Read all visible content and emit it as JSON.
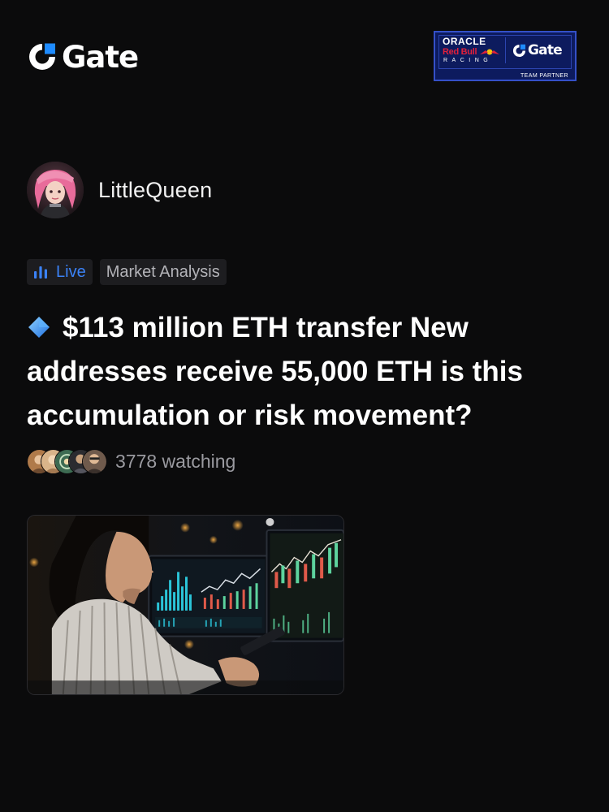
{
  "header": {
    "brand": "Gate",
    "brand_icon": "gate-logo-icon",
    "brand_color": "#1e8bff",
    "partner": {
      "line1": "ORACLE",
      "line2": "Red Bull",
      "line3": "RACING",
      "gate": "Gate",
      "badge": "TEAM PARTNER",
      "bg_color": "#0d1b5e"
    }
  },
  "author": {
    "name": "LittleQueen",
    "avatar_icon": "avatar"
  },
  "tags": {
    "live_label": "Live",
    "live_icon": "bar-chart-icon",
    "live_color": "#3b82f6",
    "category": "Market Analysis"
  },
  "post": {
    "title_icon": "blue-diamond-icon",
    "title": "$113 million ETH transfer New addresses receive 55,000 ETH is this accumulation or risk movement?"
  },
  "audience": {
    "watching": "3778 watching",
    "avatar_count": 5
  },
  "cover": {
    "image": "woman-analyzing-trading-charts"
  }
}
